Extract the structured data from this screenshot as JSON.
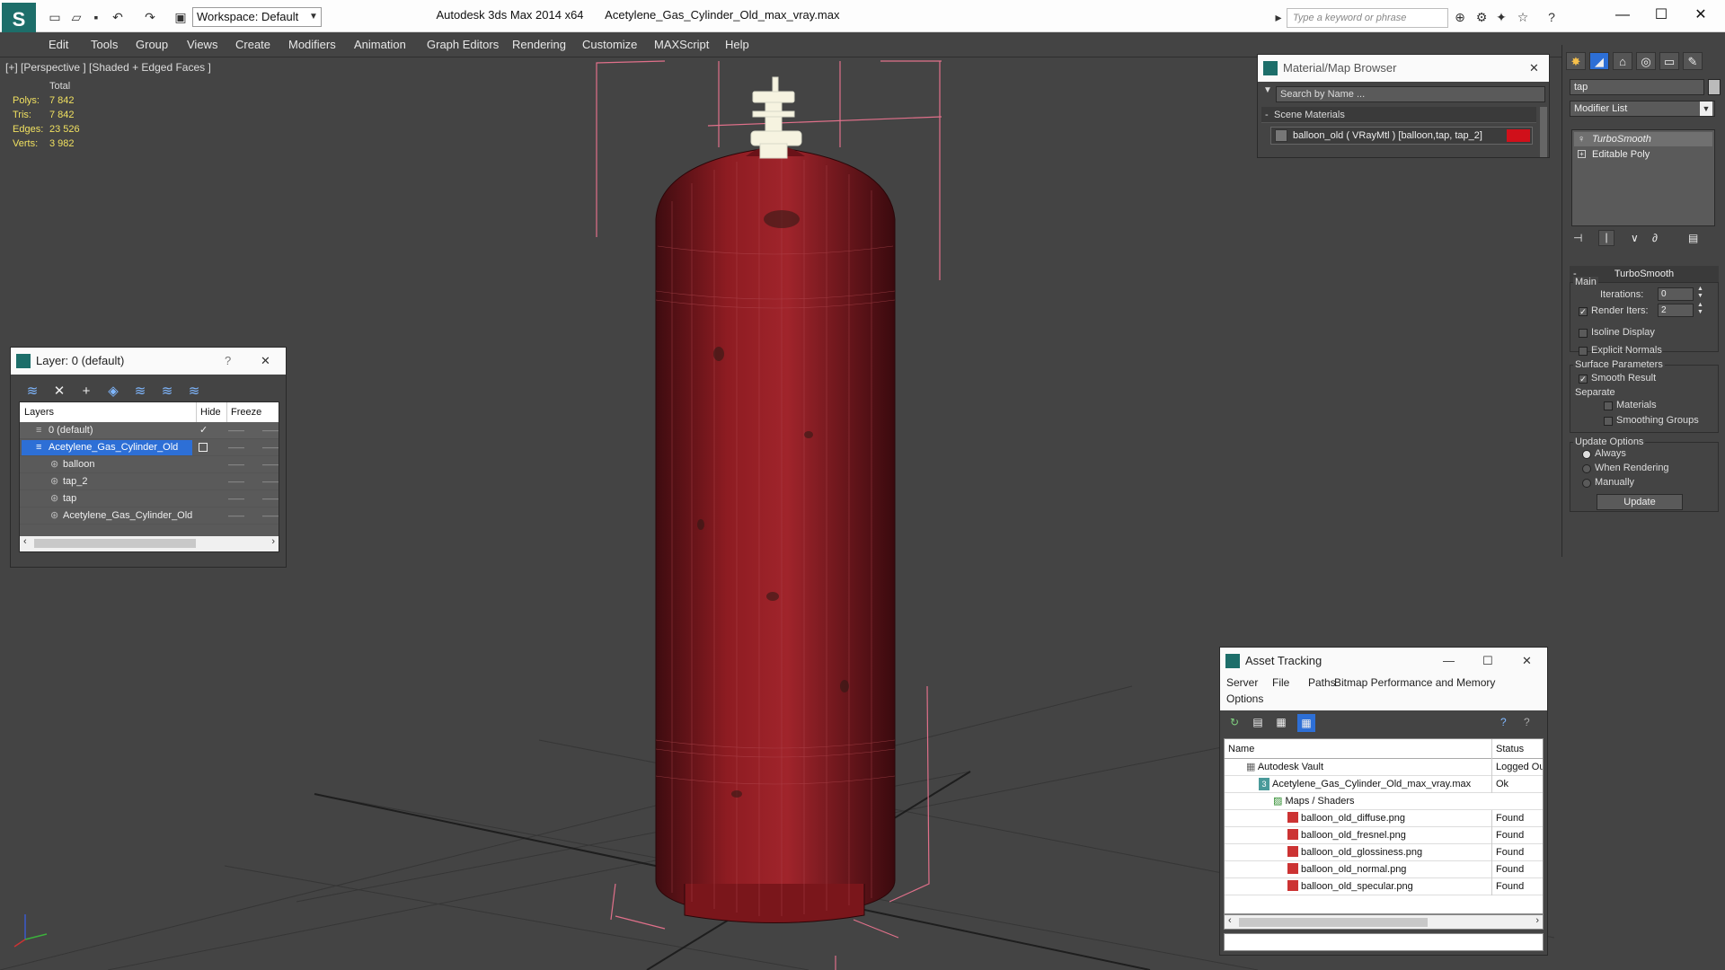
{
  "app": {
    "title": "Autodesk 3ds Max  2014 x64",
    "file": "Acetylene_Gas_Cylinder_Old_max_vray.max",
    "workspace": "Workspace: Default",
    "search_placeholder": "Type a keyword or phrase"
  },
  "menu": [
    "Edit",
    "Tools",
    "Group",
    "Views",
    "Create",
    "Modifiers",
    "Animation",
    "Graph Editors",
    "Rendering",
    "Customize",
    "MAXScript",
    "Help"
  ],
  "viewport": {
    "label": "[+] [Perspective ] [Shaded + Edged Faces ]",
    "stats": {
      "header": "Total",
      "rows": [
        {
          "label": "Polys:",
          "value": "7 842"
        },
        {
          "label": "Tris:",
          "value": "7 842"
        },
        {
          "label": "Edges:",
          "value": "23 526"
        },
        {
          "label": "Verts:",
          "value": "3 982"
        }
      ]
    }
  },
  "layer_panel": {
    "title": "Layer: 0 (default)",
    "help": "?",
    "columns": {
      "layers": "Layers",
      "hide": "Hide",
      "freeze": "Freeze"
    },
    "rows": [
      {
        "name": "0 (default)"
      },
      {
        "name": "Acetylene_Gas_Cylinder_Old"
      },
      {
        "name": "balloon"
      },
      {
        "name": "tap_2"
      },
      {
        "name": "tap"
      },
      {
        "name": "Acetylene_Gas_Cylinder_Old"
      }
    ]
  },
  "material_browser": {
    "title": "Material/Map Browser",
    "search_placeholder": "Search by Name ...",
    "group": "Scene Materials",
    "item": "balloon_old  ( VRayMtl )  [balloon,tap, tap_2]",
    "swatch_color": "#d0101a"
  },
  "command_panel": {
    "search_value": "tap",
    "modifier_list": "Modifier List",
    "stack": [
      "TurboSmooth",
      "Editable Poly"
    ],
    "rollout_title": "TurboSmooth",
    "main": {
      "label": "Main",
      "iterations_label": "Iterations:",
      "iterations_value": "0",
      "render_iters_label": "Render Iters:",
      "render_iters_value": "2",
      "isoline": "Isoline Display",
      "explicit_normals": "Explicit Normals"
    },
    "surface": {
      "label": "Surface Parameters",
      "smooth_result": "Smooth Result",
      "separate": "Separate",
      "materials": "Materials",
      "smoothing_groups": "Smoothing Groups"
    },
    "update": {
      "label": "Update Options",
      "always": "Always",
      "when_rendering": "When Rendering",
      "manually": "Manually",
      "button": "Update"
    }
  },
  "asset_tracking": {
    "title": "Asset Tracking",
    "menu": [
      "Server",
      "File",
      "Paths",
      "Bitmap Performance and Memory",
      "Options"
    ],
    "columns": {
      "name": "Name",
      "status": "Status"
    },
    "rows": [
      {
        "name": "Autodesk Vault",
        "status": "Logged Out",
        "indent": 0
      },
      {
        "name": "Acetylene_Gas_Cylinder_Old_max_vray.max",
        "status": "Ok",
        "indent": 1
      },
      {
        "name": "Maps / Shaders",
        "status": "",
        "indent": 2
      },
      {
        "name": "balloon_old_diffuse.png",
        "status": "Found",
        "indent": 3
      },
      {
        "name": "balloon_old_fresnel.png",
        "status": "Found",
        "indent": 3
      },
      {
        "name": "balloon_old_glossiness.png",
        "status": "Found",
        "indent": 3
      },
      {
        "name": "balloon_old_normal.png",
        "status": "Found",
        "indent": 3
      },
      {
        "name": "balloon_old_specular.png",
        "status": "Found",
        "indent": 3
      }
    ]
  },
  "colors": {
    "viewport_bg": "#444444",
    "selection": "#2d6fd6",
    "stats_text": "#f0e060",
    "cylinder_red": "#8e1c22"
  }
}
